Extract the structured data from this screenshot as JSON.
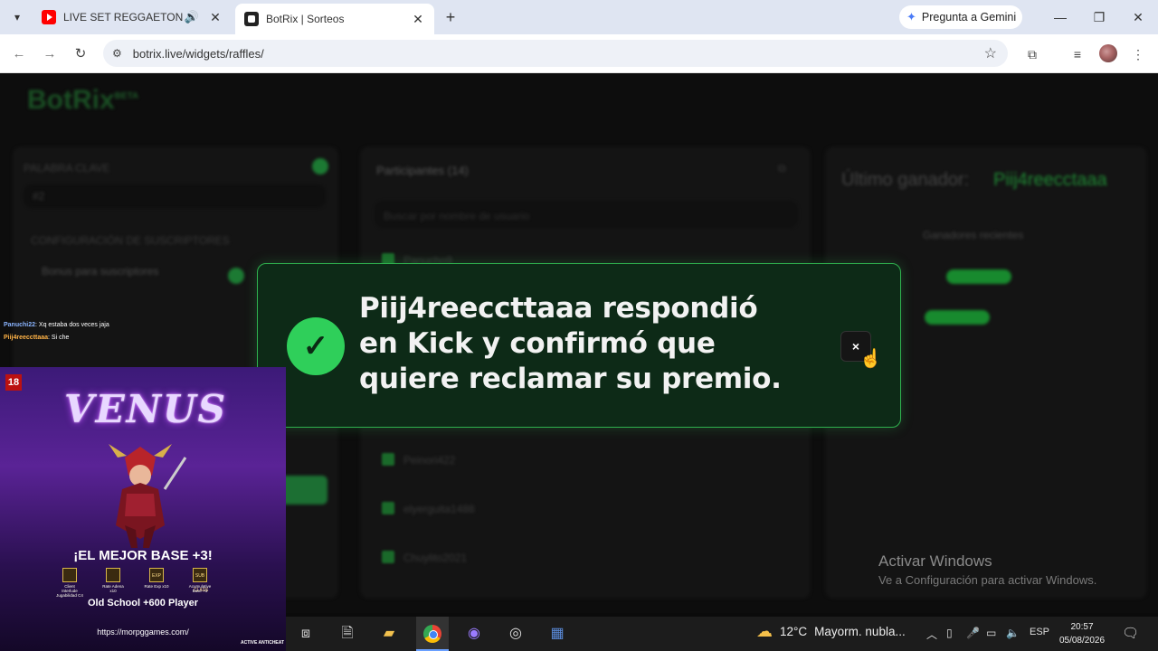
{
  "browser": {
    "tabs": [
      {
        "title": "LIVE SET REGGAETON OLD",
        "favicon": "youtube-icon",
        "audio": true
      },
      {
        "title": "BotRix | Sorteos",
        "favicon": "botrix-icon",
        "active": true
      }
    ],
    "gemini_label": "Pregunta a Gemini",
    "url": "botrix.live/widgets/raffles/"
  },
  "page": {
    "logo": "BotRix",
    "logo_badge": "BETA",
    "panels": {
      "left_keyword_label": "PALABRA CLAVE",
      "left_keyword_value": "#2",
      "left_sub_config": "CONFIGURACIÓN DE SUSCRIPTORES",
      "left_sub_bonus": "Bonus para suscriptores",
      "participants_title": "Participantes (14)",
      "search_placeholder": "Buscar por nombre de usuario",
      "participants": [
        "Panucho9",
        "Peinori422",
        "elyerguita1488",
        "Chuylito2021"
      ],
      "last_winner_label": "Último ganador:",
      "last_winner_name": "Piij4reecctaaa",
      "recent_winners_title": "Ganadores recientes"
    }
  },
  "modal": {
    "message_line1": "Piij4reeccttaaa respondió",
    "message_line2": "en Kick y confirmó que",
    "message_line3": "quiere reclamar su premio.",
    "close_label": "×",
    "accent": "#2fcf5a"
  },
  "overlay": {
    "chat": [
      {
        "user": "Panuchi22",
        "text": ": Xq estaba dos veces jaja"
      },
      {
        "user": "Piij4reeccttaaa",
        "text": ": Si che"
      }
    ],
    "ad": {
      "age": "18",
      "logo": "VENUS",
      "headline": "¡EL MEJOR BASE +3!",
      "features": [
        {
          "icon": "",
          "label": "Client Interlude Jugabilidad C4"
        },
        {
          "icon": "",
          "label": "Rate Adena x10"
        },
        {
          "icon": "EXP",
          "label": "Rate Exp x10"
        },
        {
          "icon": "SUB CLASS",
          "label": "Acumulative Base +3"
        }
      ],
      "sub": "Old School +600 Player",
      "url": "https://morpggames.com/",
      "badge": "ACTIVE ANTICHEAT"
    }
  },
  "windows": {
    "activate_title": "Activar Windows",
    "activate_sub": "Ve a Configuración para activar Windows.",
    "weather_temp": "12°C",
    "weather_desc": "Mayorm. nubla...",
    "lang": "ESP",
    "time": "20:57",
    "date": "05/08/2026"
  }
}
